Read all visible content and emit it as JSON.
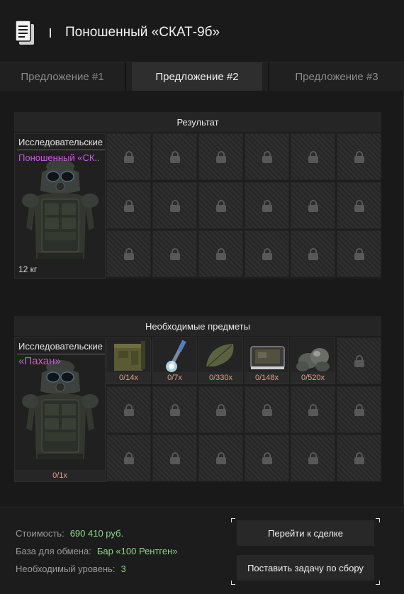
{
  "header": {
    "title": "Поношенный «СКАТ-9б»",
    "icon": "document-icon"
  },
  "tabs": [
    {
      "label": "Предложение #1",
      "active": false
    },
    {
      "label": "Предложение #2",
      "active": true
    },
    {
      "label": "Предложение #3",
      "active": false
    }
  ],
  "result": {
    "heading": "Результат",
    "item": {
      "category": "Исследовательские",
      "name": "Поношенный «СК..",
      "weight": "12 кг"
    },
    "locked_slots": 18
  },
  "required": {
    "heading": "Необходимые предметы",
    "item": {
      "category": "Исследовательские",
      "name": "«Пахан»",
      "count": "0/1x"
    },
    "items": [
      {
        "icon": "ammo-box-icon",
        "count": "0/14x"
      },
      {
        "icon": "syringe-icon",
        "count": "0/7x"
      },
      {
        "icon": "leaf-icon",
        "count": "0/330x"
      },
      {
        "icon": "device-case-icon",
        "count": "0/148x"
      },
      {
        "icon": "ore-pile-icon",
        "count": "0/520x"
      }
    ]
  },
  "footer": {
    "cost_label": "Стоимость:",
    "cost_value": "690 410 руб.",
    "base_label": "База для обмена:",
    "base_value": "Бар «100 Рентген»",
    "level_label": "Необходимый уровень:",
    "level_value": "3",
    "button_deal": "Перейти к сделке",
    "button_task": "Поставить задачу по сбору"
  },
  "colors": {
    "accent_purple": "#c45ed6",
    "value_green": "#8ed48e",
    "count_orange": "#e0a08a"
  }
}
